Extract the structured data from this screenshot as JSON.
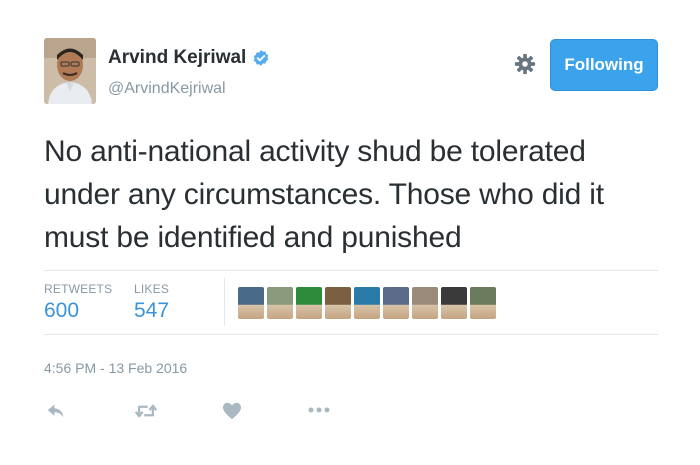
{
  "user": {
    "name": "Arvind Kejriwal",
    "handle": "@ArvindKejriwal"
  },
  "follow_button_label": "Following",
  "tweet": {
    "text_lines": [
      "No anti-national activity shud be tolerated",
      "under any circumstances. Those who did it",
      "must be identified and punished"
    ]
  },
  "stats": {
    "retweets_label": "RETWEETS",
    "retweets_value": "600",
    "likes_label": "LIKES",
    "likes_value": "547"
  },
  "liker_avatars": [
    {
      "color": "#4a6a8a"
    },
    {
      "color": "#8a9a7a"
    },
    {
      "color": "#2e8b3a"
    },
    {
      "color": "#7a6040"
    },
    {
      "color": "#2a7aaa"
    },
    {
      "color": "#5a6a8a"
    },
    {
      "color": "#9a8a7a"
    },
    {
      "color": "#3a3a3a"
    },
    {
      "color": "#6a7a5a"
    }
  ],
  "timestamp": "4:56 PM - 13 Feb 2016",
  "icons": {
    "gear": "gear-icon",
    "verified": "verified-badge-icon",
    "reply": "reply-icon",
    "retweet": "retweet-icon",
    "like": "heart-icon",
    "more": "more-icon"
  },
  "colors": {
    "accent": "#3ba3ec",
    "verified": "#55acee",
    "stat_value": "#3b94d9",
    "muted": "#8899a6",
    "action_icon": "#aab8c2"
  }
}
